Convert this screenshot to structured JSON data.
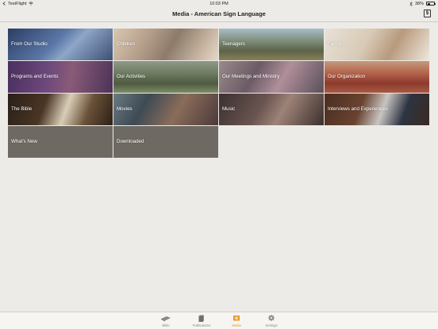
{
  "status": {
    "carrier": "TestFlight",
    "time": "10:03 PM",
    "battery": "38%"
  },
  "navbar": {
    "title": "Media - American Sign Language",
    "lang_icon": "sign-language-icon"
  },
  "tiles": [
    {
      "label": "From Our Studio"
    },
    {
      "label": "Children"
    },
    {
      "label": "Teenagers"
    },
    {
      "label": "Family"
    },
    {
      "label": "Programs and Events"
    },
    {
      "label": "Our Activities"
    },
    {
      "label": "Our Meetings and Ministry"
    },
    {
      "label": "Our Organization"
    },
    {
      "label": "The Bible"
    },
    {
      "label": "Movies"
    },
    {
      "label": "Music"
    },
    {
      "label": "Interviews and Experiences"
    },
    {
      "label": "What's New"
    },
    {
      "label": "Downloaded"
    }
  ],
  "tabs": [
    {
      "label": "Bible",
      "icon": "bible-icon",
      "active": false
    },
    {
      "label": "Publications",
      "icon": "publications-icon",
      "active": false
    },
    {
      "label": "Media",
      "icon": "media-icon",
      "active": true
    },
    {
      "label": "Settings",
      "icon": "settings-icon",
      "active": false
    }
  ],
  "colors": {
    "accent": "#e49a2b",
    "background": "#ecebe8",
    "plain_tile": "#6e6a63"
  }
}
